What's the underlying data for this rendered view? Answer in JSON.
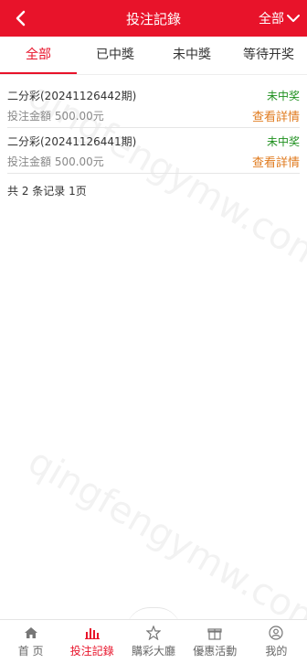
{
  "header": {
    "title": "投注記錄",
    "filter_label": "全部"
  },
  "tabs": [
    {
      "label": "全部",
      "active": true
    },
    {
      "label": "已中獎",
      "active": false
    },
    {
      "label": "未中獎",
      "active": false
    },
    {
      "label": "等待开奖",
      "active": false
    }
  ],
  "records": [
    {
      "name": "二分彩(20241126442期)",
      "status": "未中奖",
      "amount": "投注金額 500.00元",
      "detail_label": "查看詳情"
    },
    {
      "name": "二分彩(20241126441期)",
      "status": "未中奖",
      "amount": "投注金額 500.00元",
      "detail_label": "查看詳情"
    }
  ],
  "summary": "共 2 条记录 1页",
  "watermark": "qingfengymw.com",
  "bottom_nav": [
    {
      "label": "首 页",
      "icon": "home-icon",
      "active": false
    },
    {
      "label": "投注記錄",
      "icon": "bar-chart-icon",
      "active": true
    },
    {
      "label": "購彩大廳",
      "icon": "star-icon",
      "active": false
    },
    {
      "label": "優惠活動",
      "icon": "gift-icon",
      "active": false
    },
    {
      "label": "我的",
      "icon": "user-icon",
      "active": false
    }
  ],
  "colors": {
    "brand": "#e8132a",
    "win_status": "#1d8f1d",
    "detail_link": "#e07b1f"
  }
}
